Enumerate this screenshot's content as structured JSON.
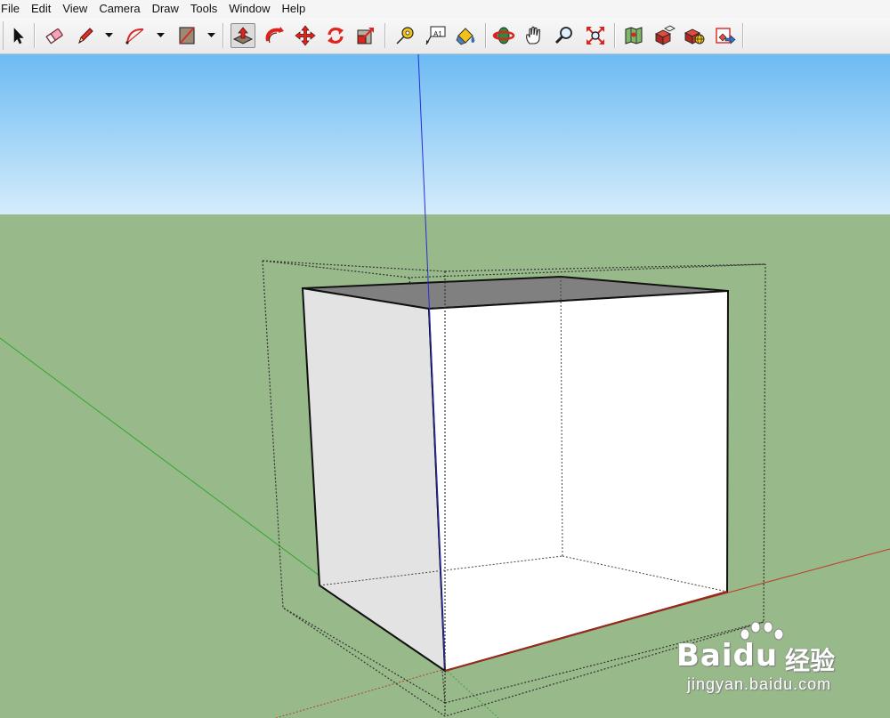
{
  "menu": {
    "file": "File",
    "edit": "Edit",
    "view": "View",
    "camera": "Camera",
    "draw": "Draw",
    "tools": "Tools",
    "window": "Window",
    "help": "Help"
  },
  "toolbar": {
    "tools": [
      {
        "name": "select-tool-button",
        "icon": "arrow-cursor-icon"
      },
      {
        "name": "eraser-tool-button",
        "icon": "eraser-icon"
      },
      {
        "name": "pencil-tool-button",
        "icon": "pencil-icon"
      },
      {
        "name": "arc-tool-button",
        "icon": "arc-icon"
      },
      {
        "name": "rectangle-tool-button",
        "icon": "rectangle-icon"
      },
      {
        "name": "push-pull-tool-button",
        "icon": "push-pull-icon",
        "active": true
      },
      {
        "name": "follow-me-tool-button",
        "icon": "follow-me-icon"
      },
      {
        "name": "move-tool-button",
        "icon": "move-icon"
      },
      {
        "name": "rotate-tool-button",
        "icon": "rotate-icon"
      },
      {
        "name": "scale-tool-button",
        "icon": "scale-icon"
      },
      {
        "name": "tape-measure-tool-button",
        "icon": "tape-measure-icon"
      },
      {
        "name": "text-tool-button",
        "icon": "text-icon"
      },
      {
        "name": "paint-bucket-tool-button",
        "icon": "paint-bucket-icon"
      },
      {
        "name": "orbit-tool-button",
        "icon": "orbit-icon"
      },
      {
        "name": "pan-tool-button",
        "icon": "pan-hand-icon"
      },
      {
        "name": "zoom-tool-button",
        "icon": "magnifier-icon"
      },
      {
        "name": "zoom-extents-tool-button",
        "icon": "zoom-extents-icon"
      },
      {
        "name": "add-location-button",
        "icon": "map-location-icon"
      },
      {
        "name": "components-button",
        "icon": "components-icon"
      },
      {
        "name": "warehouse-button",
        "icon": "warehouse-icon"
      },
      {
        "name": "share-model-button",
        "icon": "share-model-icon"
      }
    ],
    "text_tool_label": "A1"
  },
  "viewport": {
    "sky_top_color": "#6cbbf3",
    "sky_bottom_color": "#d5ecfb",
    "ground_color": "#98b98a",
    "axis_colors": {
      "red": "#c0392b",
      "green": "#2fa82f",
      "blue": "#2b2bd6"
    }
  },
  "watermark": {
    "brand": "Bai",
    "brand_suffix": "du",
    "cn": "经验",
    "url": "jingyan.baidu.com"
  }
}
